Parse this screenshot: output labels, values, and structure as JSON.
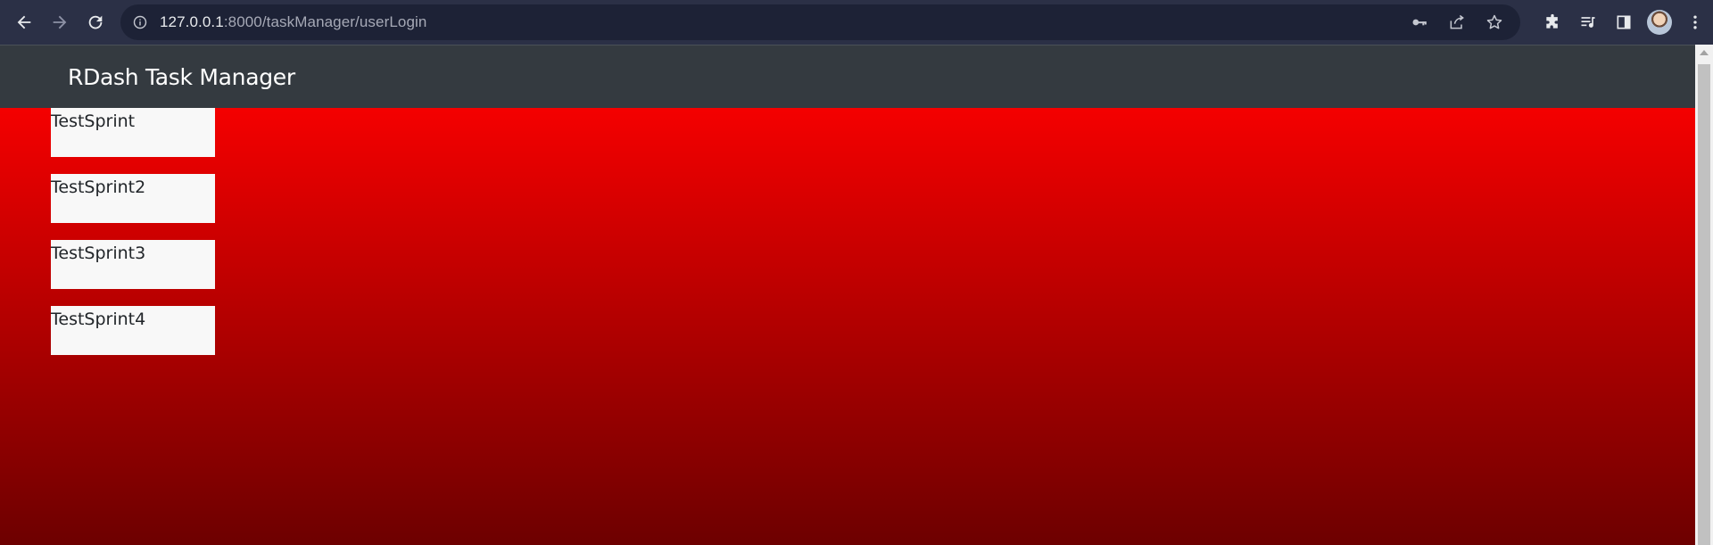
{
  "browser": {
    "url_host": "127.0.0.1",
    "url_rest": ":8000/taskManager/userLogin",
    "icons": [
      "back-icon",
      "forward-icon",
      "reload-icon",
      "info-icon",
      "key-icon",
      "share-icon",
      "star-icon",
      "extensions-icon",
      "media-icon",
      "side-panel-icon",
      "avatar",
      "menu-icon"
    ]
  },
  "app": {
    "brand": "RDash Task Manager",
    "sprints": [
      {
        "label": "TestSprint"
      },
      {
        "label": "TestSprint2"
      },
      {
        "label": "TestSprint3"
      },
      {
        "label": "TestSprint4"
      }
    ]
  },
  "colors": {
    "navbar": "#343a40",
    "gradient_top": "#ff0000",
    "gradient_bottom": "#6d0000",
    "card": "#f8f8f8"
  }
}
